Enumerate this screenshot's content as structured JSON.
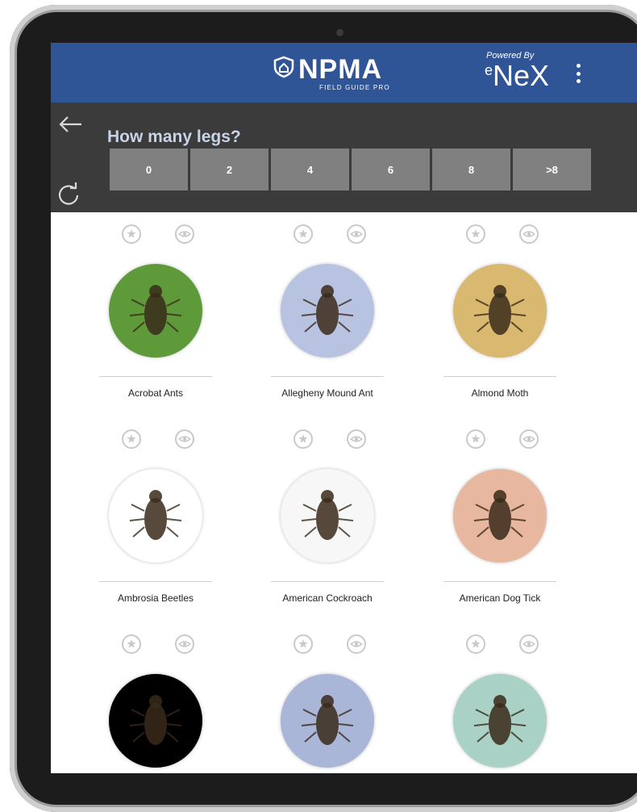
{
  "header": {
    "brand_name": "NPMA",
    "brand_sub": "FIELD GUIDE PRO",
    "powered_by": "Powered By",
    "partner": "NeX",
    "partner_prefix": "e",
    "bar_color": "#2f5597"
  },
  "question": {
    "title": "How many legs?",
    "options": [
      "0",
      "2",
      "4",
      "6",
      "8",
      ">8"
    ]
  },
  "nav": {
    "back_icon": "arrow-left-icon",
    "refresh_icon": "refresh-icon"
  },
  "insects": [
    {
      "name": "Acrobat Ants",
      "bg": "#5f9a3a"
    },
    {
      "name": "Allegheny Mound Ant",
      "bg": "#b8c3e2"
    },
    {
      "name": "Almond Moth",
      "bg": "#d9b870"
    },
    {
      "name": "Ambrosia Beetles",
      "bg": "#ffffff"
    },
    {
      "name": "American Cockroach",
      "bg": "#f7f7f7"
    },
    {
      "name": "American Dog Tick",
      "bg": "#e8b7a0"
    },
    {
      "name": "",
      "bg": "#000000"
    },
    {
      "name": "",
      "bg": "#aab6d8"
    },
    {
      "name": "",
      "bg": "#a9d1c6"
    }
  ]
}
